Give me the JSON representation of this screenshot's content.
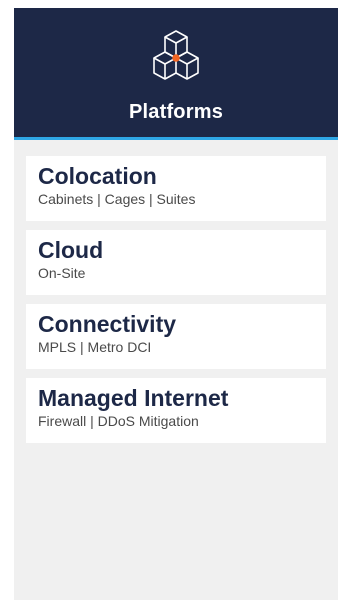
{
  "header": {
    "title": "Platforms",
    "icon": "cubes-icon",
    "background_color": "#1d2847",
    "accent_color": "#2fa7e6",
    "node_color": "#f26522"
  },
  "menu": {
    "items": [
      {
        "title": "Colocation",
        "subtitle": "Cabinets | Cages | Suites"
      },
      {
        "title": "Cloud",
        "subtitle": "On-Site"
      },
      {
        "title": "Connectivity",
        "subtitle": "MPLS | Metro DCI"
      },
      {
        "title": "Managed Internet",
        "subtitle": "Firewall | DDoS Mitigation"
      }
    ]
  }
}
